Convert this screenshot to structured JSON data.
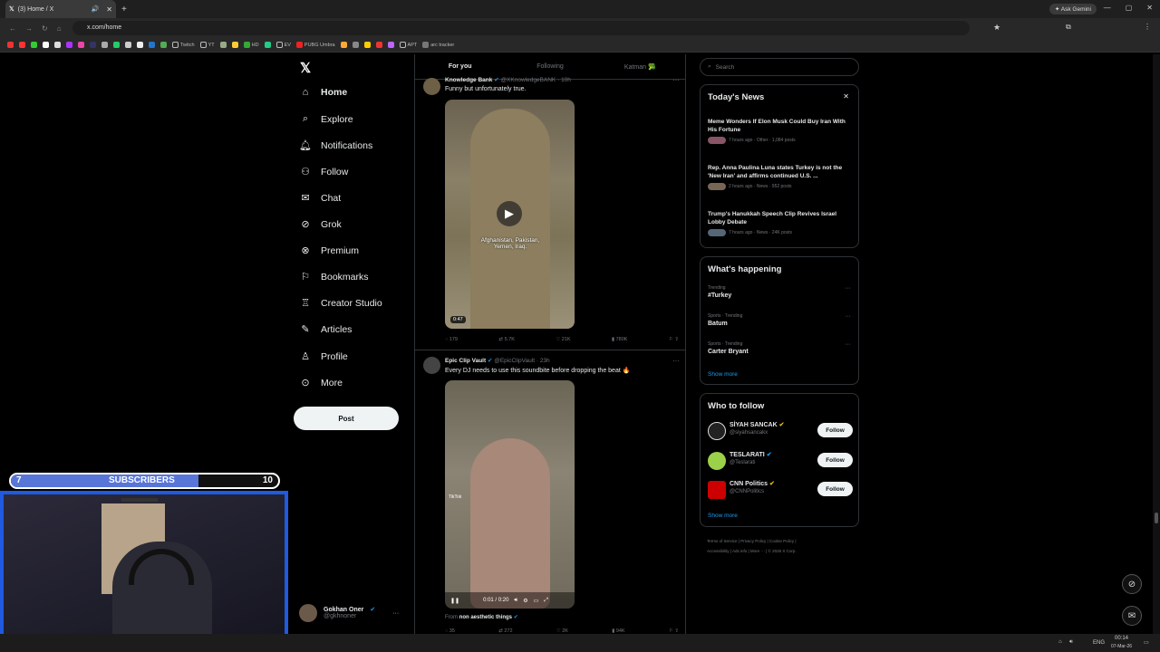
{
  "browser": {
    "tab_title": "(3) Home / X",
    "url": "x.com/home",
    "gemini_label": "Ask Gemini",
    "bookmarks": [
      "Twitch",
      "YT",
      "HD",
      "EV",
      "PUBG Umbra",
      "APT",
      "arc tracker"
    ]
  },
  "nav": {
    "items": [
      {
        "label": "Home",
        "icon": "home-icon"
      },
      {
        "label": "Explore",
        "icon": "search-icon"
      },
      {
        "label": "Notifications",
        "icon": "bell-icon"
      },
      {
        "label": "Follow",
        "icon": "person-add-icon"
      },
      {
        "label": "Chat",
        "icon": "mail-icon"
      },
      {
        "label": "Grok",
        "icon": "grok-icon"
      },
      {
        "label": "Premium",
        "icon": "x-circle-icon"
      },
      {
        "label": "Bookmarks",
        "icon": "bookmark-icon"
      },
      {
        "label": "Creator Studio",
        "icon": "creator-icon"
      },
      {
        "label": "Articles",
        "icon": "articles-icon"
      },
      {
        "label": "Profile",
        "icon": "person-icon"
      },
      {
        "label": "More",
        "icon": "more-icon"
      }
    ],
    "post_label": "Post",
    "account": {
      "name": "Gokhan Oner",
      "handle": "@gkhnoner"
    }
  },
  "feed": {
    "tabs": [
      "For you",
      "Following",
      "Katman 🥦"
    ],
    "tweets": [
      {
        "author": "Knowledge Bank",
        "handle": "@XKnowledgeBANK",
        "time": "10h",
        "text": "Funny but unfortunately true.",
        "video_caption": "Afghanistan, Pakistan, Yemen, Iraq.",
        "duration": "0:47",
        "stats": {
          "replies": "179",
          "reposts": "5.7K",
          "likes": "21K",
          "views": "780K"
        }
      },
      {
        "author": "Epic Clip Vault",
        "handle": "@EpicClipVault",
        "time": "23h",
        "text": "Every DJ needs to use this soundbite before dropping the beat 🔥",
        "video_time": "0:01 / 0:20",
        "tiktok_label": "TikTok",
        "from_prefix": "From",
        "from_source": "non aesthetic things",
        "stats": {
          "replies": "35",
          "reposts": "272",
          "likes": "2K",
          "views": "94K"
        }
      }
    ]
  },
  "sidebar": {
    "search_placeholder": "Search",
    "todays_news": {
      "title": "Today's News",
      "items": [
        {
          "headline": "Meme Wonders If Elon Musk Could Buy Iran With His Fortune",
          "meta": "7 hours ago · Other · 1,084 posts"
        },
        {
          "headline": "Rep. Anna Paulina Luna states Turkey is not the 'New Iran' and affirms continued U.S. ...",
          "meta": "2 hours ago · News · 952 posts"
        },
        {
          "headline": "Trump's Hanukkah Speech Clip Revives Israel Lobby Debate",
          "meta": "7 hours ago · News · 24K posts"
        }
      ]
    },
    "whats_happening": {
      "title": "What's happening",
      "items": [
        {
          "context": "Trending",
          "topic": "#Turkey"
        },
        {
          "context": "Sports · Trending",
          "topic": "Batum"
        },
        {
          "context": "Sports · Trending",
          "topic": "Carter Bryant"
        }
      ],
      "show_more": "Show more"
    },
    "who_to_follow": {
      "title": "Who to follow",
      "items": [
        {
          "name": "SİYAH SANCAK",
          "handle": "@siyahsancakx",
          "button": "Follow"
        },
        {
          "name": "TESLARATI",
          "handle": "@Teslarati",
          "button": "Follow"
        },
        {
          "name": "CNN Politics",
          "handle": "@CNNPolitics",
          "button": "Follow"
        }
      ],
      "show_more": "Show more"
    },
    "footer": [
      "Terms of Service",
      "Privacy Policy",
      "Cookie Policy",
      "Accessibility",
      "Ads info",
      "More ···",
      "© 2026 X Corp."
    ]
  },
  "overlay": {
    "sub_current": "7",
    "sub_label": "SUBSCRIBERS",
    "sub_goal": "10",
    "sub_fraction": 0.7
  },
  "taskbar": {
    "lang": "ENG",
    "time": "00:14",
    "date": "07-Mar-26"
  },
  "colors": {
    "accent": "#1d9bf0",
    "background": "#000000",
    "border": "#2f3336",
    "subscriber_bar": "#5876d8",
    "webcam_border": "#1f5ae0"
  }
}
